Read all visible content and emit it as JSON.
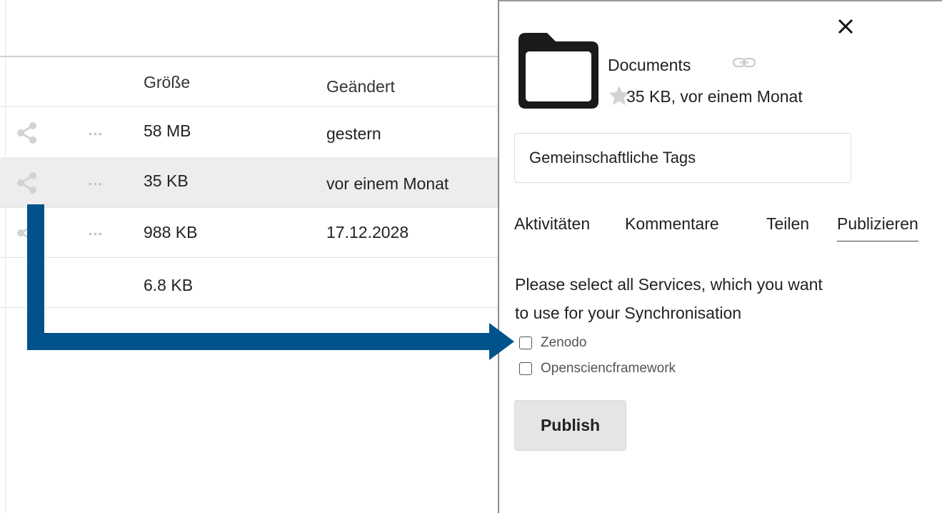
{
  "file_list": {
    "headers": {
      "size": "Größe",
      "modified": "Geändert"
    },
    "rows": [
      {
        "size": "58 MB",
        "modified": "gestern",
        "selected": false
      },
      {
        "size": "35 KB",
        "modified": "vor einem Monat",
        "selected": true
      },
      {
        "size": "988 KB",
        "modified": "17.12.2028",
        "selected": false
      },
      {
        "size": "6.8 KB",
        "modified": "",
        "selected": false
      }
    ],
    "row_icons": [
      "share-icon",
      "more-icon"
    ]
  },
  "sidebar": {
    "close_icon": "close-icon",
    "folder": {
      "icon": "folder-icon",
      "name": "Documents",
      "link_icon": "link-icon",
      "star_icon": "star-icon",
      "meta": "35 KB, vor einem Monat"
    },
    "tags_placeholder": "Gemeinschaftliche Tags",
    "tabs": [
      {
        "label": "Aktivitäten",
        "active": false
      },
      {
        "label": "Kommentare",
        "active": false
      },
      {
        "label": "Teilen",
        "active": false
      },
      {
        "label": "Publizieren",
        "active": true
      }
    ],
    "publish_panel": {
      "intro_line1": "Please select all Services, which you want",
      "intro_line2": "to use for your Synchronisation",
      "services": [
        {
          "label": "Zenodo",
          "checked": false
        },
        {
          "label": "Opensciencframework",
          "checked": false
        }
      ],
      "publish_label": "Publish"
    }
  },
  "annotation": {
    "arrow_color": "#00538a"
  },
  "colors": {
    "selected_row": "#ededed",
    "accent": "#00538a"
  }
}
